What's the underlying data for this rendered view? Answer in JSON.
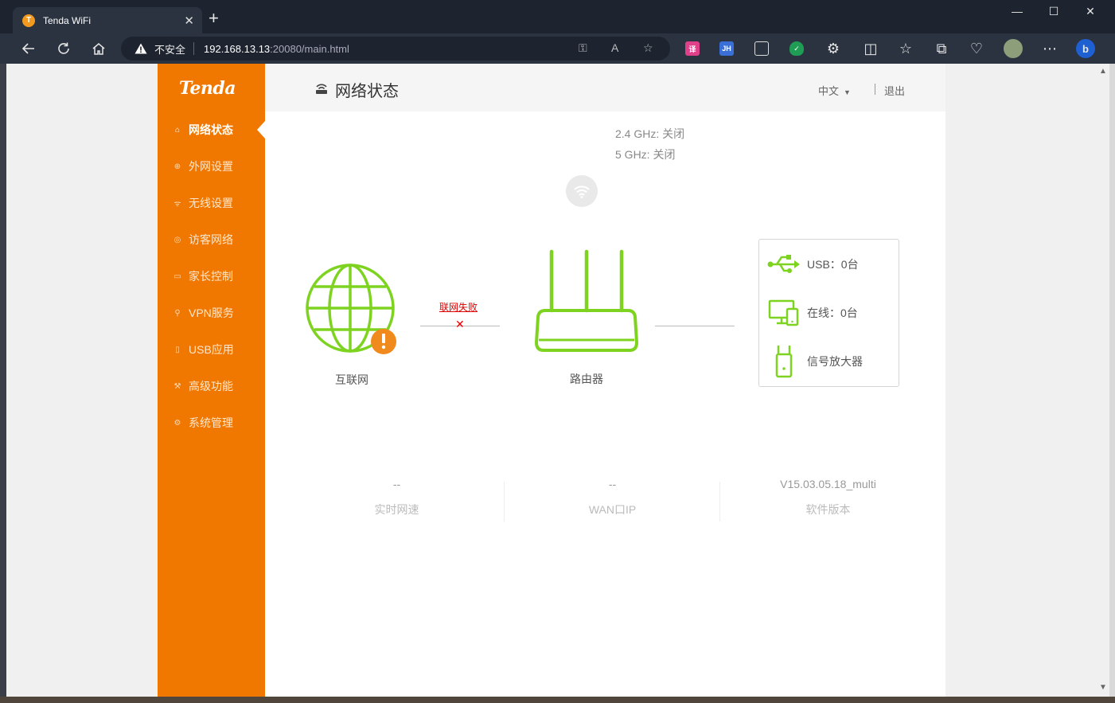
{
  "browser": {
    "tab_title": "Tenda WiFi",
    "tab_favicon": "tenda-favicon",
    "tab_close": "✕",
    "new_tab": "+",
    "window_controls": {
      "minimize": "—",
      "maximize": "☐",
      "close": "✕"
    },
    "insecure_label": "不安全",
    "url_host": "192.168.13.13",
    "url_rest": ":20080/main.html"
  },
  "sidebar": {
    "logo": "Tenda",
    "items": [
      {
        "label": "网络状态",
        "icon": "router-icon",
        "glyph": "⌂",
        "active": true
      },
      {
        "label": "外网设置",
        "icon": "globe-icon",
        "glyph": "⊕"
      },
      {
        "label": "无线设置",
        "icon": "wifi-icon",
        "glyph": "ᯤ"
      },
      {
        "label": "访客网络",
        "icon": "guest-icon",
        "glyph": "◎"
      },
      {
        "label": "家长控制",
        "icon": "parental-icon",
        "glyph": "▭"
      },
      {
        "label": "VPN服务",
        "icon": "vpn-icon",
        "glyph": "⚲"
      },
      {
        "label": "USB应用",
        "icon": "usb-icon",
        "glyph": "▯"
      },
      {
        "label": "高级功能",
        "icon": "tools-icon",
        "glyph": "⚒"
      },
      {
        "label": "系统管理",
        "icon": "settings-icon",
        "glyph": "⚙"
      }
    ]
  },
  "header": {
    "title": "网络状态",
    "language": "中文",
    "logout": "退出"
  },
  "wifi": {
    "band_24": "2.4 GHz: 关闭",
    "band_5": "5 GHz: 关闭"
  },
  "topology": {
    "internet_label": "互联网",
    "fail_text": "联网失败",
    "fail_mark": "✕",
    "router_label": "路由器",
    "accent_color": "#7ed321",
    "warning_color": "#f08a1c"
  },
  "devices": {
    "usb": "USB：0台",
    "online": "在线：0台",
    "extender": "信号放大器"
  },
  "stats": [
    {
      "value": "--",
      "label": "实时网速"
    },
    {
      "value": "--",
      "label": "WAN口IP"
    },
    {
      "value": "V15.03.05.18_multi",
      "label": "软件版本"
    }
  ],
  "colors": {
    "sidebar": "#f07800",
    "accent_green": "#7ed321",
    "error_red": "#dd0000"
  }
}
